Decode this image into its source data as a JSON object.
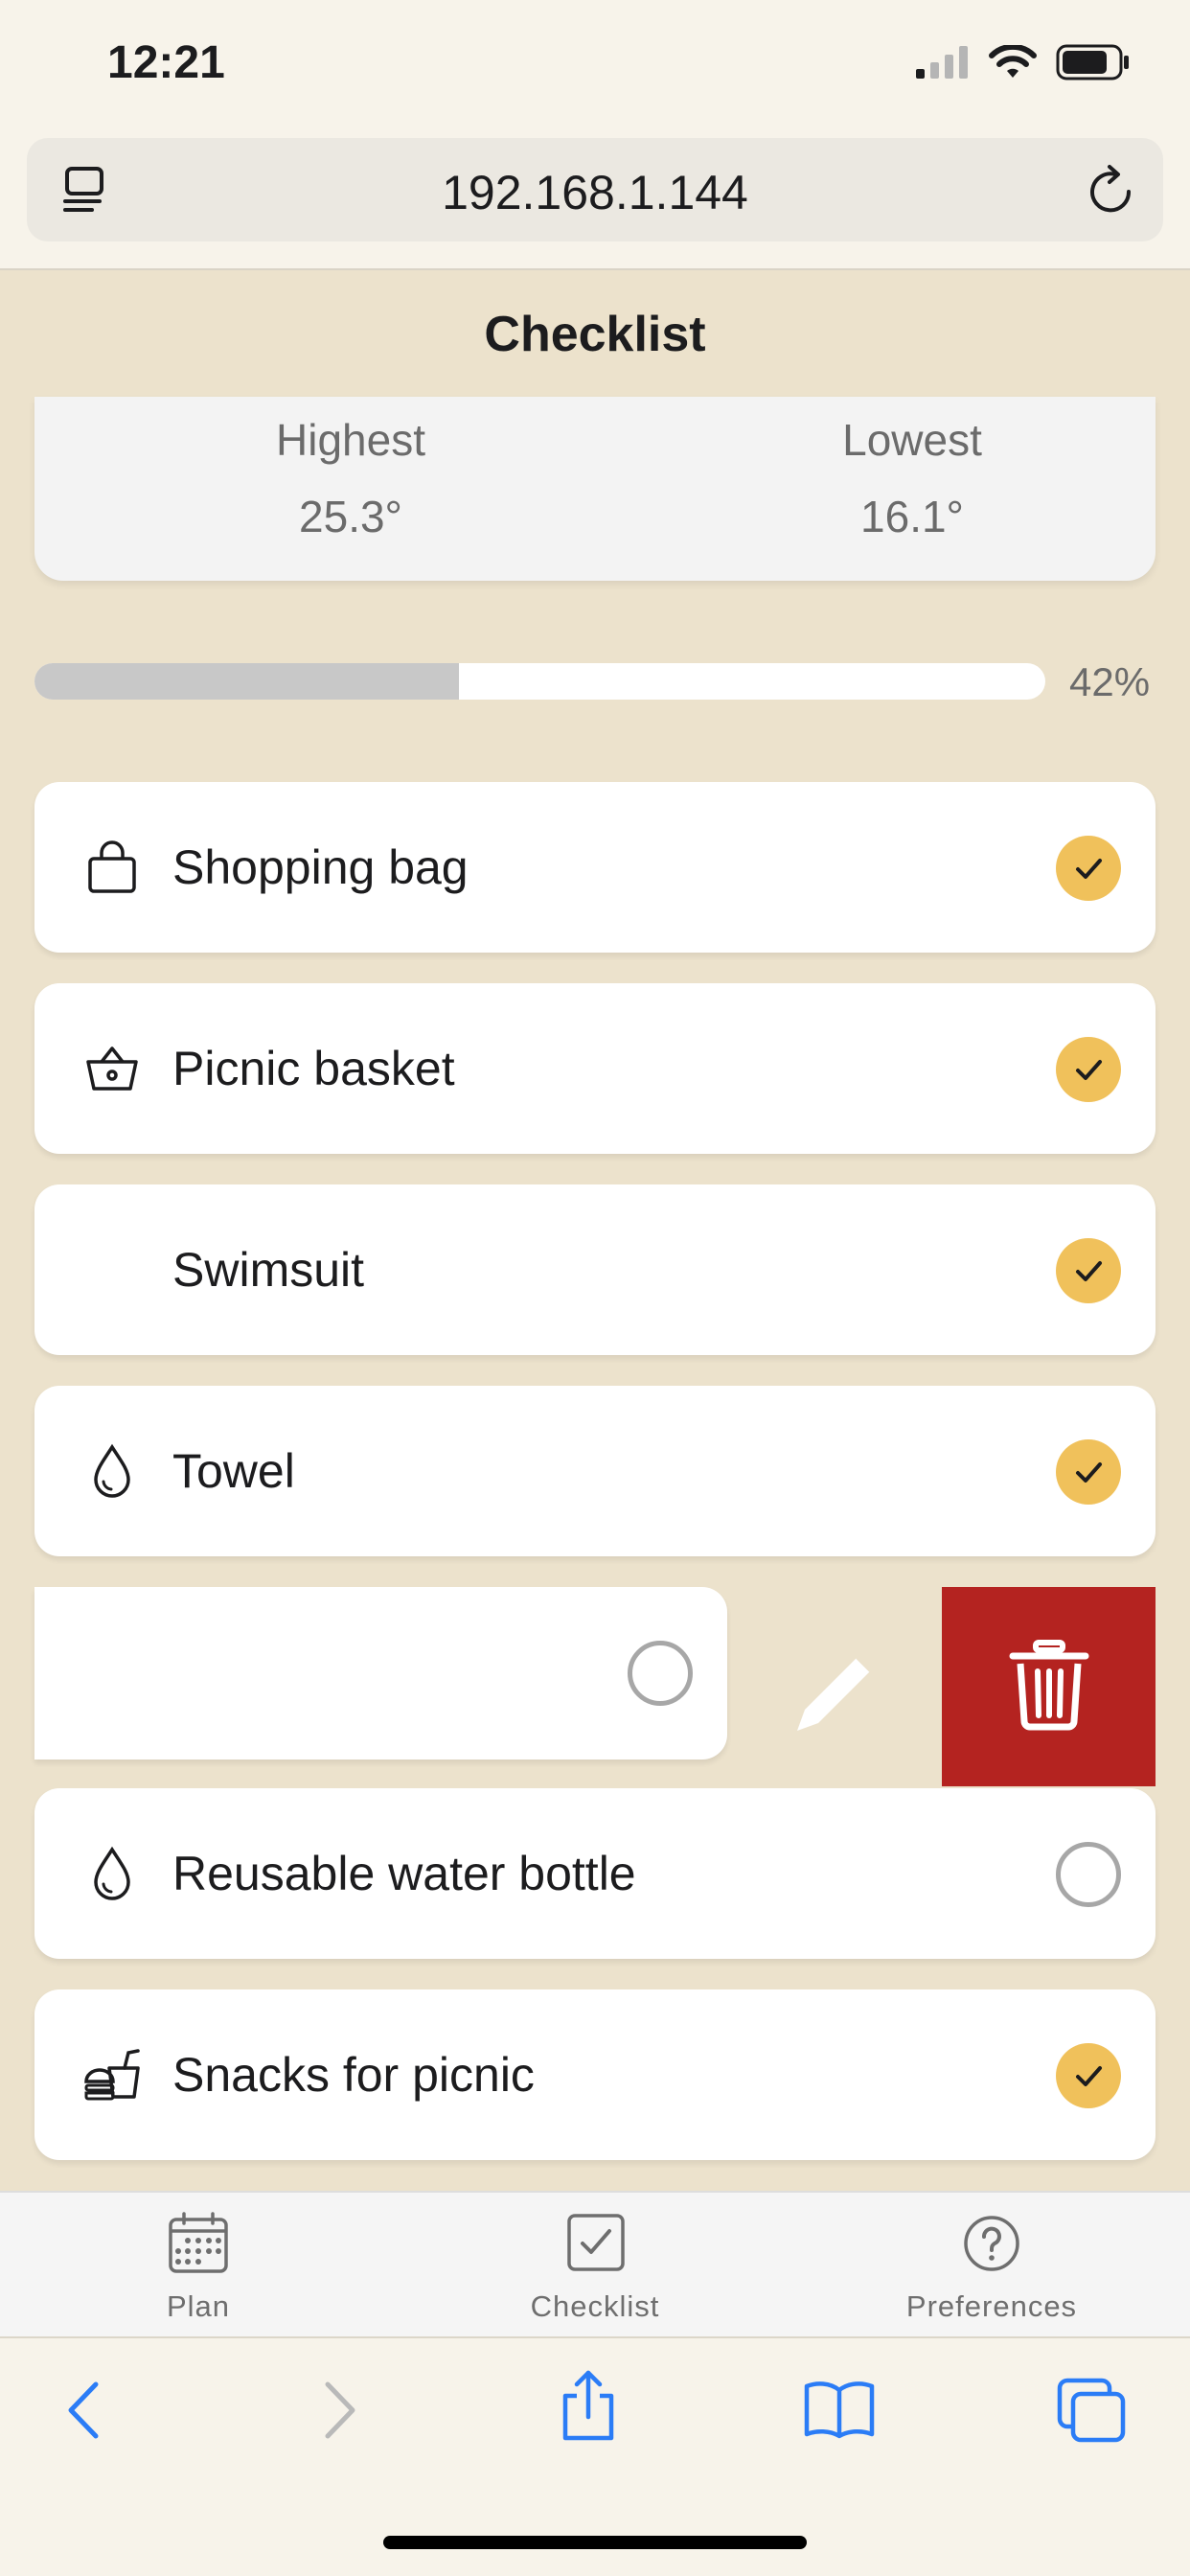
{
  "status_bar": {
    "time": "12:21"
  },
  "browser": {
    "url": "192.168.1.144"
  },
  "header": {
    "title": "Checklist"
  },
  "weather": {
    "highest_label": "Highest",
    "highest_value": "25.3°",
    "lowest_label": "Lowest",
    "lowest_value": "16.1°"
  },
  "progress": {
    "percent": 42,
    "label": "42%"
  },
  "items": [
    {
      "label": "Shopping bag",
      "icon": "shopping-bag-icon",
      "checked": true
    },
    {
      "label": "Picnic basket",
      "icon": "basket-icon",
      "checked": true
    },
    {
      "label": "Swimsuit",
      "icon": "",
      "checked": true
    },
    {
      "label": "Towel",
      "icon": "drop-icon",
      "checked": true
    },
    {
      "label": "",
      "icon": "",
      "checked": false
    },
    {
      "label": "Reusable water bottle",
      "icon": "drop-icon",
      "checked": false
    },
    {
      "label": "Snacks for picnic",
      "icon": "fast-food-icon",
      "checked": true
    }
  ],
  "actions": {
    "edit_icon": "pencil-icon",
    "delete_icon": "trash-icon",
    "delete_color": "#b42320"
  },
  "tabs": [
    {
      "label": "Plan",
      "icon": "calendar-icon"
    },
    {
      "label": "Checklist",
      "icon": "checkbox-icon"
    },
    {
      "label": "Preferences",
      "icon": "question-icon"
    }
  ],
  "colors": {
    "background": "#ece2cc",
    "check_accent": "#f0c15b",
    "browser_blue": "#2b7cf6"
  }
}
